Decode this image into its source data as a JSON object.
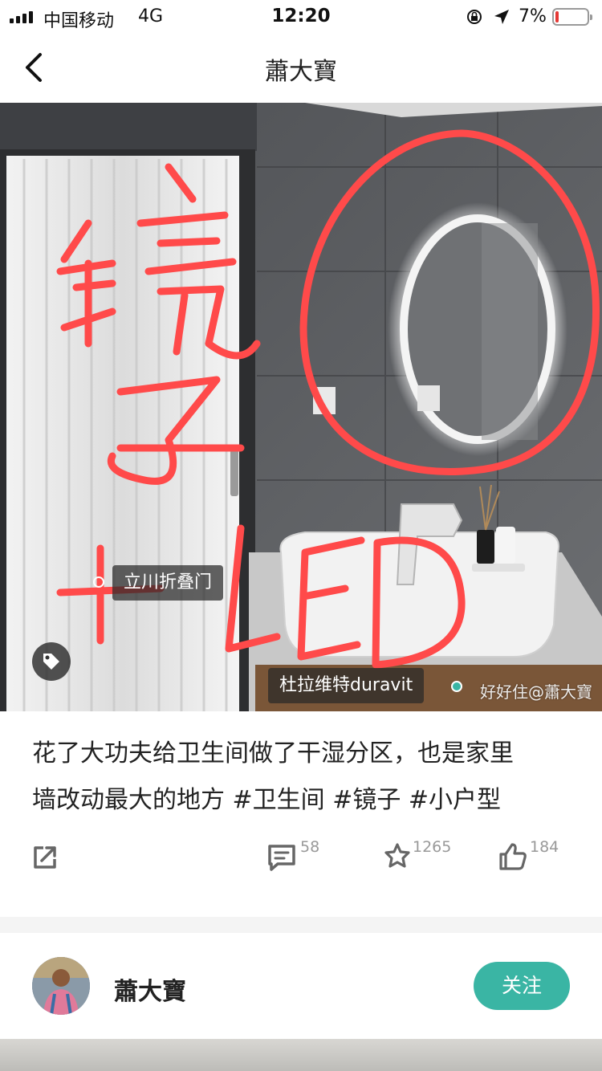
{
  "status_bar": {
    "carrier": "中国移动",
    "network": "4G",
    "time": "12:20",
    "battery_percent": "7%",
    "battery_level": 0.07,
    "battery_color": "#e53935"
  },
  "nav": {
    "title": "蕭大寶",
    "back_icon": "chevron-left-icon"
  },
  "photo": {
    "tags": [
      {
        "label": "立川折叠门"
      },
      {
        "label": "杜拉维特duravit"
      }
    ],
    "handwriting": "镜子 + LED",
    "watermark": "好好住@蕭大寶"
  },
  "post": {
    "text_line1": "花了大功夫给卫生间做了干湿分区，也是家里",
    "text_line2": "墙改动最大的地方 #卫生间 #镜子 #小户型"
  },
  "actions": {
    "share_icon": "share-icon",
    "comment_icon": "comment-icon",
    "comment_count": "58",
    "favorite_icon": "star-icon",
    "favorite_count": "1265",
    "like_icon": "thumbs-up-icon",
    "like_count": "184"
  },
  "author": {
    "name": "蕭大寶",
    "follow_label": "关注"
  },
  "colors": {
    "accent": "#3ab5a4",
    "annotation": "#ff4a4a"
  }
}
